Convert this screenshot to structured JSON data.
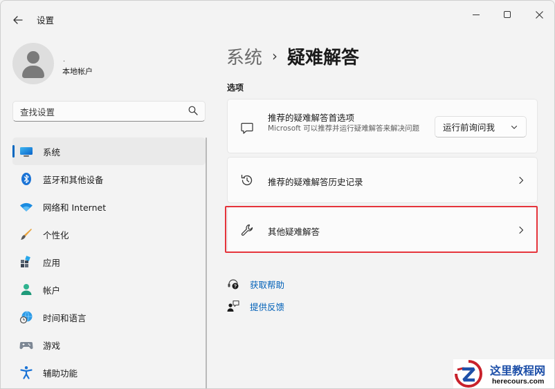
{
  "window": {
    "title": "设置",
    "back_icon": "arrow-left-icon",
    "controls": [
      "minimize-icon",
      "maximize-icon",
      "close-icon"
    ]
  },
  "profile": {
    "dot": ".",
    "account_type": "本地帐户"
  },
  "search": {
    "placeholder": "查找设置",
    "icon": "search-icon"
  },
  "sidebar": {
    "items": [
      {
        "label": "系统",
        "icon": "monitor-icon",
        "active": true
      },
      {
        "label": "蓝牙和其他设备",
        "icon": "bluetooth-icon"
      },
      {
        "label": "网络和 Internet",
        "icon": "wifi-icon"
      },
      {
        "label": "个性化",
        "icon": "brush-icon"
      },
      {
        "label": "应用",
        "icon": "apps-icon"
      },
      {
        "label": "帐户",
        "icon": "person-icon"
      },
      {
        "label": "时间和语言",
        "icon": "globe-clock-icon"
      },
      {
        "label": "游戏",
        "icon": "gamepad-icon"
      },
      {
        "label": "辅助功能",
        "icon": "accessibility-icon"
      }
    ]
  },
  "breadcrumb": {
    "parent": "系统",
    "separator": "›",
    "current": "疑难解答"
  },
  "main": {
    "section_title": "选项",
    "cards": [
      {
        "title": "推荐的疑难解答首选项",
        "description": "Microsoft 可以推荐并运行疑难解答来解决问题",
        "icon": "chat-bubble-icon",
        "dropdown_value": "运行前询问我"
      },
      {
        "title": "推荐的疑难解答历史记录",
        "icon": "history-icon"
      },
      {
        "title": "其他疑难解答",
        "icon": "wrench-icon"
      }
    ],
    "links": [
      {
        "label": "获取帮助",
        "icon": "help-icon"
      },
      {
        "label": "提供反馈",
        "icon": "feedback-icon"
      }
    ]
  },
  "watermark": {
    "title": "这里教程网",
    "url": "herecours.com"
  },
  "colors": {
    "accent": "#0067c0",
    "link": "#0060b8",
    "highlight_border": "#e5333a"
  }
}
